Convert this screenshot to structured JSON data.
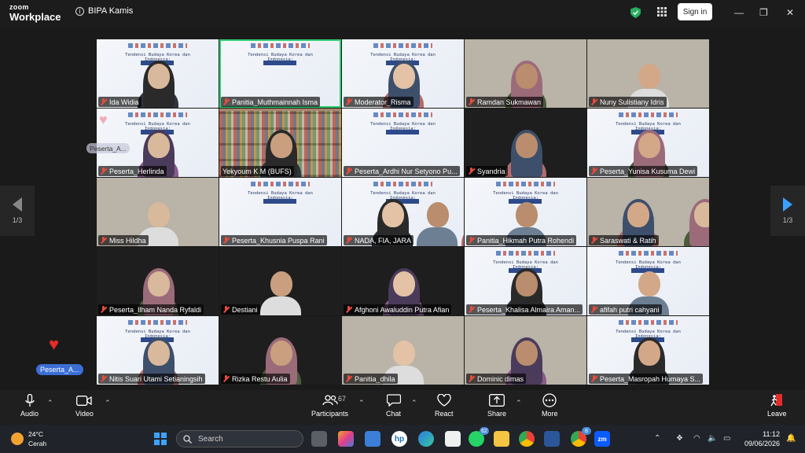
{
  "titlebar": {
    "app_name_top": "zoom",
    "app_name_bottom": "Workplace",
    "meeting_title": "BIPA Kamis",
    "sign_in_label": "Sign in"
  },
  "slide": {
    "title": "Tendensi Budaya Korea dan Indonesia:",
    "subtitle": "Perspektif komparatif"
  },
  "participants": [
    {
      "name": "Ida Widia",
      "kind": "slide-person",
      "muted": true
    },
    {
      "name": "Panitia_Muthmainnah Isma",
      "kind": "slide",
      "muted": true,
      "active": true
    },
    {
      "name": "Moderator_Risma",
      "kind": "slide-person",
      "muted": true
    },
    {
      "name": "Ramdan Sukmawan",
      "kind": "photo",
      "muted": true
    },
    {
      "name": "Nuny Sulistiany Idris",
      "kind": "photo",
      "muted": true
    },
    {
      "name": "Peserta_Herlinda",
      "kind": "slide-person",
      "muted": true
    },
    {
      "name": "Yekyoum K M (BUFS)",
      "kind": "bookshelf",
      "muted": false
    },
    {
      "name": "Peserta_Ardhi Nur Setyono Pu...",
      "kind": "slide",
      "muted": true
    },
    {
      "name": "Syandria",
      "kind": "dark-person",
      "muted": true
    },
    {
      "name": "Peserta_Yunisa Kusuma Dewi",
      "kind": "slide-person",
      "muted": true
    },
    {
      "name": "Miss Hildha",
      "kind": "photo",
      "muted": true
    },
    {
      "name": "Peserta_Khusnia Puspa Rani",
      "kind": "slide",
      "muted": true
    },
    {
      "name": "NADA, FIA, JARA",
      "kind": "slide-group",
      "muted": true
    },
    {
      "name": "Panitia_Hikmah Putra Rohendi",
      "kind": "slide-person",
      "muted": true
    },
    {
      "name": "Saraswati & Ratih",
      "kind": "photo",
      "muted": true
    },
    {
      "name": "Peserta_Ilham Nanda Ryfaldi",
      "kind": "dark-person",
      "muted": true
    },
    {
      "name": "Destiani",
      "kind": "dark-person",
      "muted": true
    },
    {
      "name": "Afghoni Awaluddin Putra Afian",
      "kind": "dark-person",
      "muted": true
    },
    {
      "name": "Peserta_Khalisa Almaira Aman...",
      "kind": "slide-person",
      "muted": true
    },
    {
      "name": "afifah putri cahyani",
      "kind": "slide-person",
      "muted": true
    },
    {
      "name": "Nitis Suari Utami Setianingsih",
      "kind": "slide-person",
      "muted": true
    },
    {
      "name": "Rizka Restu Aulia",
      "kind": "dark-person",
      "muted": true
    },
    {
      "name": "Panitia_dhila",
      "kind": "photo",
      "muted": true
    },
    {
      "name": "Dominic dimas",
      "kind": "photo",
      "muted": true
    },
    {
      "name": "Peserta_Masropah Humaya S...",
      "kind": "slide-person",
      "muted": true
    }
  ],
  "paging": {
    "left": "1/3",
    "right": "1/3"
  },
  "reaction": {
    "label": "Peserta_A...",
    "floating_label": "Peserta_A..."
  },
  "toolbar": {
    "audio": "Audio",
    "video": "Video",
    "participants": "Participants",
    "participants_count": "67",
    "chat": "Chat",
    "react": "React",
    "share": "Share",
    "more": "More",
    "leave": "Leave"
  },
  "taskbar": {
    "temperature": "24°C",
    "weather": "Cerah",
    "search_placeholder": "Search",
    "whatsapp_badge": "62",
    "chrome_badge": "8",
    "time": "11:12",
    "date": "09/06/2026"
  },
  "colors": {
    "active_speaker": "#2ecc71",
    "muted_icon": "#e74c3c",
    "next_page_arrow": "#3aa0ff",
    "leave_icon": "#e62b2b"
  }
}
